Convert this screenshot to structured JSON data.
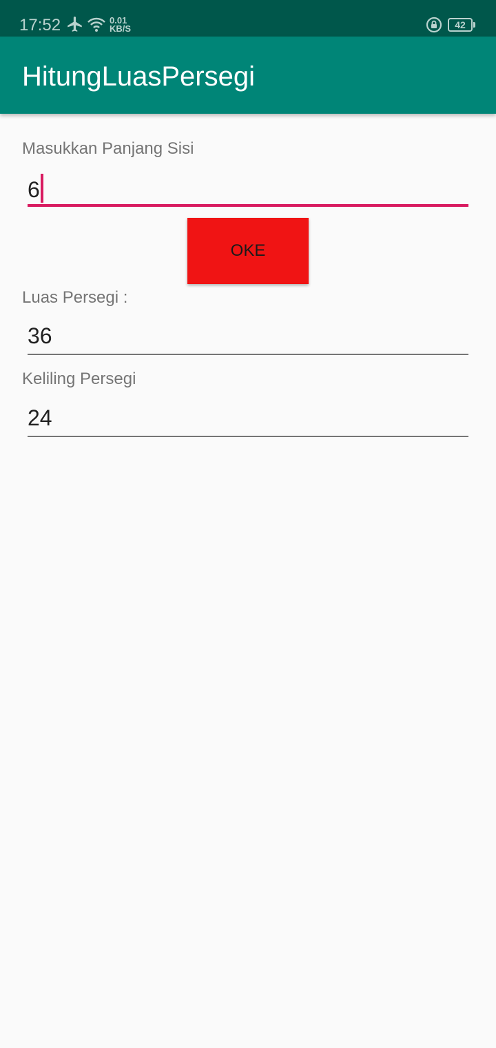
{
  "status_bar": {
    "time": "17:52",
    "speed_value": "0.01",
    "speed_unit": "KB/S",
    "battery": "42",
    "icons": [
      "airplane-icon",
      "wifi-icon",
      "rotation-lock-icon",
      "battery-icon"
    ]
  },
  "app_bar": {
    "title": "HitungLuasPersegi",
    "color": "#008577"
  },
  "form": {
    "side_label": "Masukkan Panjang Sisi",
    "side_value": "6",
    "button_label": "OKE",
    "area_label": "Luas Persegi :",
    "area_value": "36",
    "perimeter_label": "Keliling Persegi",
    "perimeter_value": "24"
  },
  "colors": {
    "status_bar": "#00574b",
    "accent": "#d81b60",
    "button": "#f01414",
    "background": "#fafafa"
  }
}
